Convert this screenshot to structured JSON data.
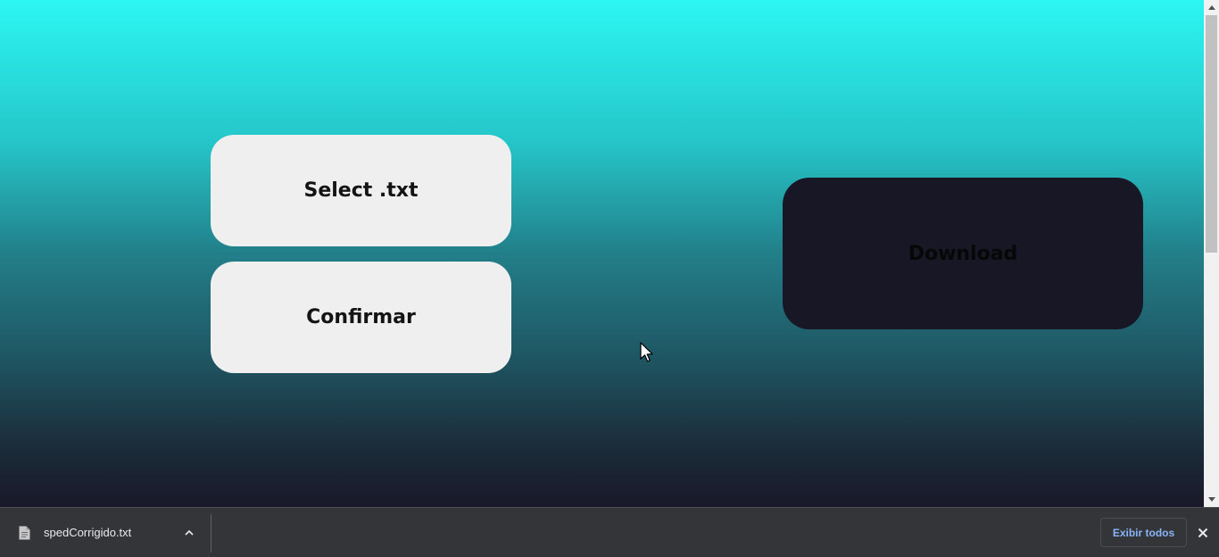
{
  "page": {
    "buttons": {
      "select_label": "Select .txt",
      "confirm_label": "Confirmar",
      "download_label": "Download"
    }
  },
  "download_shelf": {
    "file_name": "spedCorrigido.txt",
    "show_all_label": "Exibir todos"
  },
  "icons": {
    "file": "file-icon",
    "chevron": "chevron-up-icon",
    "close": "close-icon",
    "cursor": "mouse-pointer-icon"
  },
  "colors": {
    "gradient_top": "#2cf6f2",
    "gradient_bottom": "#191828",
    "button_light": "#efefef",
    "button_dark": "#181726",
    "shelf_bg": "#333539",
    "link_blue": "#8ab4f8"
  }
}
